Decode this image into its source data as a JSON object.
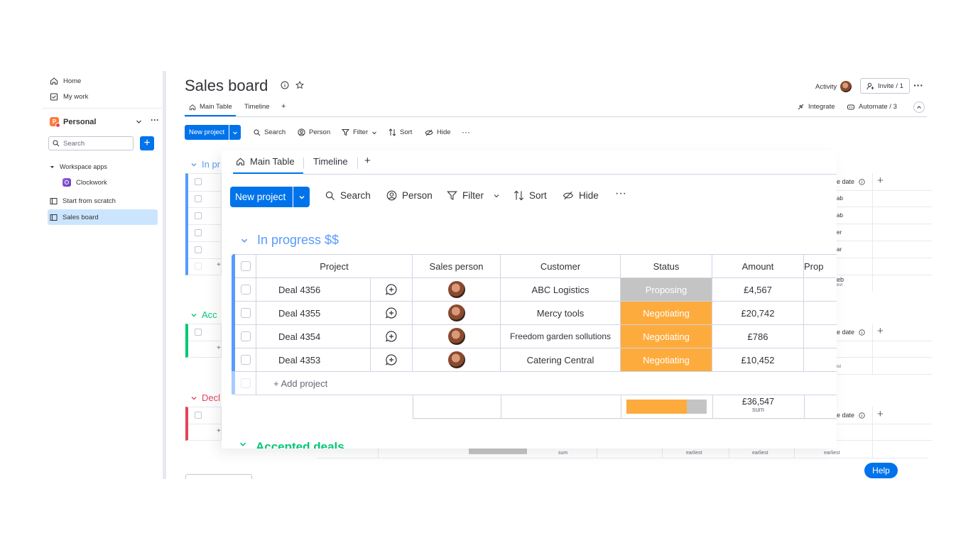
{
  "sidebar": {
    "home": "Home",
    "my_work": "My work",
    "workspace": "Personal",
    "workspace_initial": "P",
    "search_placeholder": "Search",
    "workspace_apps": "Workspace apps",
    "clockwork": "Clockwork",
    "start_from_scratch": "Start from scratch",
    "sales_board": "Sales board"
  },
  "header": {
    "title": "Sales board",
    "activity": "Activity",
    "invite": "Invite / 1",
    "integrate": "Integrate",
    "automate": "Automate / 3"
  },
  "bg_tabs": [
    "Main Table",
    "Timeline",
    "+"
  ],
  "bg_toolbar": {
    "new_project": "New project",
    "search": "Search",
    "person": "Person",
    "filter": "Filter",
    "sort": "Sort",
    "hide": "Hide"
  },
  "bg_groups": {
    "g1": "In pr",
    "g2": "Acc",
    "g3": "Decl",
    "g4": "Accepted deals",
    "col_date": "e date",
    "row_vals": [
      "ab",
      "ab",
      "er",
      "ar",
      "eb"
    ],
    "row_sub": "est",
    "row_sub2": "ist",
    "sum": "sum",
    "earliest": "earliest"
  },
  "popup": {
    "tabs": [
      "Main Table",
      "Timeline",
      "+"
    ],
    "toolbar": {
      "new_project": "New project",
      "search": "Search",
      "person": "Person",
      "filter": "Filter",
      "sort": "Sort",
      "hide": "Hide"
    },
    "group_title": "In progress $$",
    "columns": [
      "Project",
      "Sales person",
      "Customer",
      "Status",
      "Amount",
      "Prop"
    ],
    "rows": [
      {
        "project": "Deal 4356",
        "customer": "ABC Logistics",
        "status": "Proposing",
        "amount": "£4,567"
      },
      {
        "project": "Deal 4355",
        "customer": "Mercy tools",
        "status": "Negotiating",
        "amount": "£20,742"
      },
      {
        "project": "Deal 4354",
        "customer": "Freedom garden sollutions",
        "status": "Negotiating",
        "amount": "£786"
      },
      {
        "project": "Deal 4353",
        "customer": "Catering Central",
        "status": "Negotiating",
        "amount": "£10,452"
      }
    ],
    "add_project": "+ Add project",
    "total": "£36,547",
    "total_label": "sum",
    "status_summary": {
      "negotiating": 0.75,
      "proposing": 0.25
    }
  },
  "colors": {
    "primary": "#0073ea",
    "negotiating": "#fdab3d",
    "proposing": "#c4c4c4",
    "group_blue": "#579bfc",
    "group_green": "#00c875",
    "group_red": "#e2445c"
  },
  "help": "Help"
}
